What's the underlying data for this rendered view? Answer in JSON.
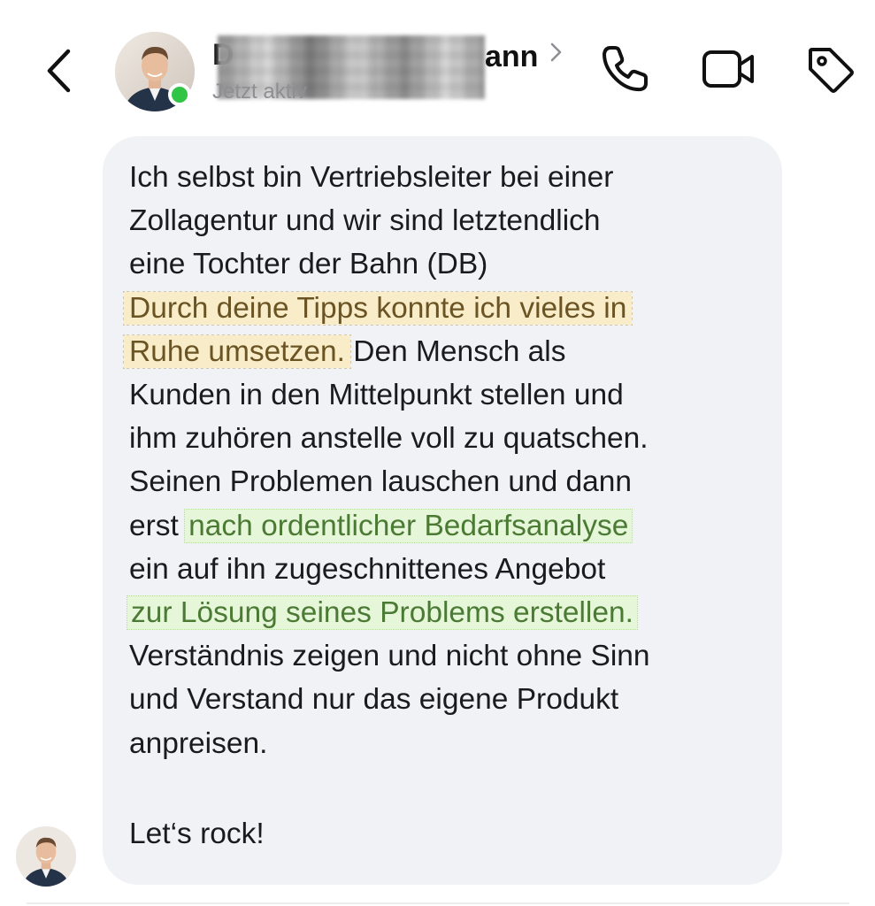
{
  "header": {
    "back_icon": "chevron-left-icon",
    "contact_name_visible_end": "ann",
    "contact_name_visible_start": "D",
    "status": "Jetzt aktiv",
    "online_color": "#31c545",
    "icons": [
      "phone-icon",
      "video-camera-icon",
      "tag-icon"
    ]
  },
  "message": {
    "part1": "Ich selbst bin Vertriebsleiter bei einer\nZollagentur und wir sind letztendlich\neine Tochter der Bahn (DB)\n",
    "highlight1": "Durch deine Tipps konnte ich vieles in\nRuhe umsetzen.",
    "part2": " Den Mensch als\nKunden in den Mittelpunkt stellen und\nihm zuhören anstelle voll zu quatschen.\nSeinen Problemen lauschen und dann\nerst ",
    "highlight2": "nach ordentlicher Bedarfsanalyse",
    "part3": "\nein auf ihn zugeschnittenes Angebot\n",
    "highlight3": "zur Lösung seines Problems erstellen.",
    "part4": "\nVerständnis zeigen und nicht ohne Sinn\nund Verstand nur das eigene Produkt\nanpreisen.",
    "signoff": "Let‘s rock!"
  },
  "colors": {
    "bubble": "#f1f2f6",
    "highlight_yellow": "#f8ecc9",
    "highlight_green": "#e6f6d8"
  }
}
